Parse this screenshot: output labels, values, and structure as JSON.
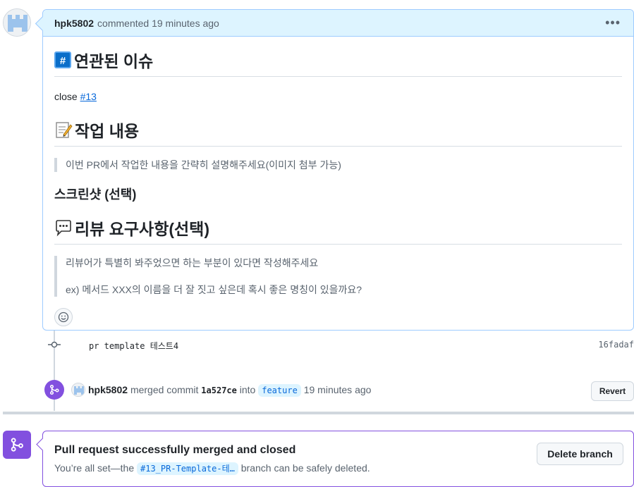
{
  "comment": {
    "author": "hpk5802",
    "meta": "commented 19 minutes ago",
    "menu_icon": "kebab-horizontal-icon",
    "heading1": "연관된 이슈",
    "close_prefix": "close",
    "close_issue": "#13",
    "heading2": "작업 내용",
    "quote1": "이번 PR에서 작업한 내용을 간략히 설명해주세요(이미지 첨부 가능)",
    "heading3": "스크린샷 (선택)",
    "heading4": "리뷰 요구사항(선택)",
    "quote2_line1": "리뷰어가 특별히 봐주었으면 하는 부분이 있다면 작성해주세요",
    "quote2_line2": "ex) 메서드 XXX의 이름을 더 잘 짓고 싶은데 혹시 좋은 명칭이 있을까요?"
  },
  "commit": {
    "message": "pr template 테스트4",
    "sha": "16fadaf"
  },
  "merged_event": {
    "user": "hpk5802",
    "text_merged": "merged commit",
    "sha": "1a527ce",
    "text_into": "into",
    "branch": "feature",
    "time": "19 minutes ago",
    "revert_label": "Revert"
  },
  "merge_status": {
    "title": "Pull request successfully merged and closed",
    "sub_prefix": "You’re all set—the",
    "branch": "#13_PR-Template-테…",
    "sub_suffix": "branch can be safely deleted.",
    "delete_label": "Delete branch"
  },
  "colors": {
    "accent_blue": "#0969da",
    "merged_purple": "#8250df",
    "header_blue_bg": "#ddf4ff"
  }
}
